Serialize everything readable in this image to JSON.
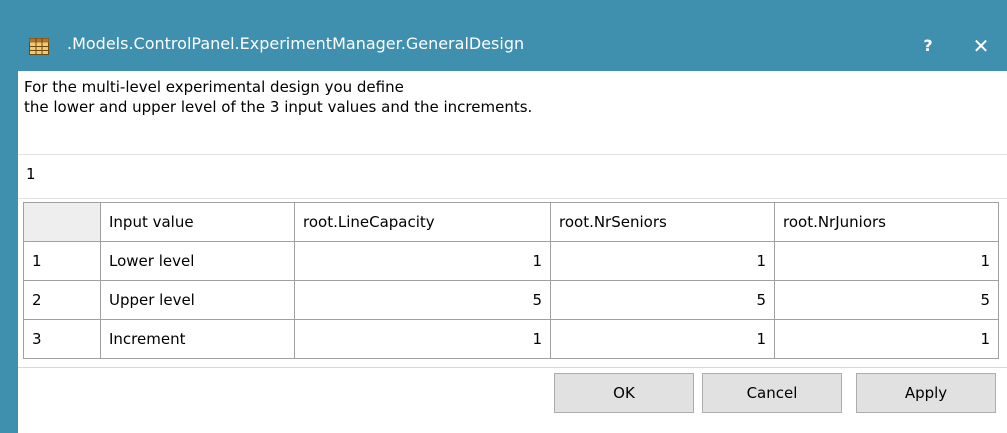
{
  "window": {
    "title": ".Models.ControlPanel.ExperimentManager.GeneralDesign",
    "help_label": "?",
    "close_label": "✕",
    "accent": "#3f8fae"
  },
  "description": {
    "line1": "For the multi-level experimental design you define",
    "line2": "the lower and upper level of the 3 input values and the increments."
  },
  "counter": "1",
  "table": {
    "headers": [
      "",
      "Input value",
      "root.LineCapacity",
      "root.NrSeniors",
      "root.NrJuniors"
    ],
    "rows": [
      {
        "index": "1",
        "label": "Lower level",
        "values": [
          "1",
          "1",
          "1"
        ]
      },
      {
        "index": "2",
        "label": "Upper level",
        "values": [
          "5",
          "5",
          "5"
        ]
      },
      {
        "index": "3",
        "label": "Increment",
        "values": [
          "1",
          "1",
          "1"
        ]
      }
    ]
  },
  "buttons": {
    "ok": "OK",
    "cancel": "Cancel",
    "apply": "Apply"
  }
}
